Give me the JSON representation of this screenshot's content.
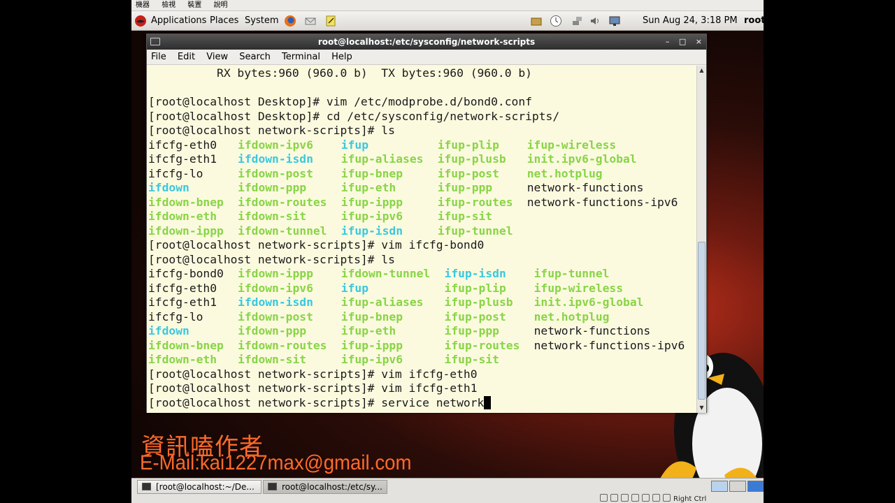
{
  "vm_menu": [
    "機器",
    "檢視",
    "裝置",
    "說明"
  ],
  "panel": {
    "menus": [
      "Applications",
      "Places",
      "System"
    ],
    "clock": "Sun Aug 24,  3:18 PM",
    "user": "root"
  },
  "window": {
    "title": "root@localhost:/etc/sysconfig/network-scripts",
    "menu": [
      "File",
      "Edit",
      "View",
      "Search",
      "Terminal",
      "Help"
    ],
    "controls": [
      "–",
      "□",
      "×"
    ]
  },
  "colors": {
    "text": "#1a1a1a",
    "exec": "#8ad448",
    "link": "#3bc8de",
    "terminal_bg": "#fbfadf",
    "watermark": "#ff6a2a"
  },
  "terminal": {
    "lines": [
      [
        {
          "t": "          RX bytes:960 (960.0 b)  TX bytes:960 (960.0 b)",
          "c": "text"
        }
      ],
      [],
      [
        {
          "t": "[root@localhost Desktop]# vim /etc/modprobe.d/bond0.conf",
          "c": "text"
        }
      ],
      [
        {
          "t": "[root@localhost Desktop]# cd /etc/sysconfig/network-scripts/",
          "c": "text"
        }
      ],
      [
        {
          "t": "[root@localhost network-scripts]# ls",
          "c": "text"
        }
      ],
      [
        {
          "t": "ifcfg-eth0",
          "c": "text",
          "col": 0
        },
        {
          "t": "ifdown-ipv6",
          "c": "exec",
          "col": 13
        },
        {
          "t": "ifup",
          "c": "link",
          "col": 28
        },
        {
          "t": "ifup-plip",
          "c": "exec",
          "col": 42
        },
        {
          "t": "ifup-wireless",
          "c": "exec",
          "col": 55
        }
      ],
      [
        {
          "t": "ifcfg-eth1",
          "c": "text",
          "col": 0
        },
        {
          "t": "ifdown-isdn",
          "c": "link",
          "col": 13
        },
        {
          "t": "ifup-aliases",
          "c": "exec",
          "col": 28
        },
        {
          "t": "ifup-plusb",
          "c": "exec",
          "col": 42
        },
        {
          "t": "init.ipv6-global",
          "c": "exec",
          "col": 55
        }
      ],
      [
        {
          "t": "ifcfg-lo",
          "c": "text",
          "col": 0
        },
        {
          "t": "ifdown-post",
          "c": "exec",
          "col": 13
        },
        {
          "t": "ifup-bnep",
          "c": "exec",
          "col": 28
        },
        {
          "t": "ifup-post",
          "c": "exec",
          "col": 42
        },
        {
          "t": "net.hotplug",
          "c": "exec",
          "col": 55
        }
      ],
      [
        {
          "t": "ifdown",
          "c": "link",
          "col": 0
        },
        {
          "t": "ifdown-ppp",
          "c": "exec",
          "col": 13
        },
        {
          "t": "ifup-eth",
          "c": "exec",
          "col": 28
        },
        {
          "t": "ifup-ppp",
          "c": "exec",
          "col": 42
        },
        {
          "t": "network-functions",
          "c": "text",
          "col": 55
        }
      ],
      [
        {
          "t": "ifdown-bnep",
          "c": "exec",
          "col": 0
        },
        {
          "t": "ifdown-routes",
          "c": "exec",
          "col": 13
        },
        {
          "t": "ifup-ippp",
          "c": "exec",
          "col": 28
        },
        {
          "t": "ifup-routes",
          "c": "exec",
          "col": 42
        },
        {
          "t": "network-functions-ipv6",
          "c": "text",
          "col": 55
        }
      ],
      [
        {
          "t": "ifdown-eth",
          "c": "exec",
          "col": 0
        },
        {
          "t": "ifdown-sit",
          "c": "exec",
          "col": 13
        },
        {
          "t": "ifup-ipv6",
          "c": "exec",
          "col": 28
        },
        {
          "t": "ifup-sit",
          "c": "exec",
          "col": 42
        }
      ],
      [
        {
          "t": "ifdown-ippp",
          "c": "exec",
          "col": 0
        },
        {
          "t": "ifdown-tunnel",
          "c": "exec",
          "col": 13
        },
        {
          "t": "ifup-isdn",
          "c": "link",
          "col": 28
        },
        {
          "t": "ifup-tunnel",
          "c": "exec",
          "col": 42
        }
      ],
      [
        {
          "t": "[root@localhost network-scripts]# vim ifcfg-bond0",
          "c": "text"
        }
      ],
      [
        {
          "t": "[root@localhost network-scripts]# ls",
          "c": "text"
        }
      ],
      [
        {
          "t": "ifcfg-bond0",
          "c": "text",
          "col": 0
        },
        {
          "t": "ifdown-ippp",
          "c": "exec",
          "col": 13
        },
        {
          "t": "ifdown-tunnel",
          "c": "exec",
          "col": 28
        },
        {
          "t": "ifup-isdn",
          "c": "link",
          "col": 43
        },
        {
          "t": "ifup-tunnel",
          "c": "exec",
          "col": 56
        }
      ],
      [
        {
          "t": "ifcfg-eth0",
          "c": "text",
          "col": 0
        },
        {
          "t": "ifdown-ipv6",
          "c": "exec",
          "col": 13
        },
        {
          "t": "ifup",
          "c": "link",
          "col": 28
        },
        {
          "t": "ifup-plip",
          "c": "exec",
          "col": 43
        },
        {
          "t": "ifup-wireless",
          "c": "exec",
          "col": 56
        }
      ],
      [
        {
          "t": "ifcfg-eth1",
          "c": "text",
          "col": 0
        },
        {
          "t": "ifdown-isdn",
          "c": "link",
          "col": 13
        },
        {
          "t": "ifup-aliases",
          "c": "exec",
          "col": 28
        },
        {
          "t": "ifup-plusb",
          "c": "exec",
          "col": 43
        },
        {
          "t": "init.ipv6-global",
          "c": "exec",
          "col": 56
        }
      ],
      [
        {
          "t": "ifcfg-lo",
          "c": "text",
          "col": 0
        },
        {
          "t": "ifdown-post",
          "c": "exec",
          "col": 13
        },
        {
          "t": "ifup-bnep",
          "c": "exec",
          "col": 28
        },
        {
          "t": "ifup-post",
          "c": "exec",
          "col": 43
        },
        {
          "t": "net.hotplug",
          "c": "exec",
          "col": 56
        }
      ],
      [
        {
          "t": "ifdown",
          "c": "link",
          "col": 0
        },
        {
          "t": "ifdown-ppp",
          "c": "exec",
          "col": 13
        },
        {
          "t": "ifup-eth",
          "c": "exec",
          "col": 28
        },
        {
          "t": "ifup-ppp",
          "c": "exec",
          "col": 43
        },
        {
          "t": "network-functions",
          "c": "text",
          "col": 56
        }
      ],
      [
        {
          "t": "ifdown-bnep",
          "c": "exec",
          "col": 0
        },
        {
          "t": "ifdown-routes",
          "c": "exec",
          "col": 13
        },
        {
          "t": "ifup-ippp",
          "c": "exec",
          "col": 28
        },
        {
          "t": "ifup-routes",
          "c": "exec",
          "col": 43
        },
        {
          "t": "network-functions-ipv6",
          "c": "text",
          "col": 56
        }
      ],
      [
        {
          "t": "ifdown-eth",
          "c": "exec",
          "col": 0
        },
        {
          "t": "ifdown-sit",
          "c": "exec",
          "col": 13
        },
        {
          "t": "ifup-ipv6",
          "c": "exec",
          "col": 28
        },
        {
          "t": "ifup-sit",
          "c": "exec",
          "col": 43
        }
      ],
      [
        {
          "t": "[root@localhost network-scripts]# vim ifcfg-eth0",
          "c": "text"
        }
      ],
      [
        {
          "t": "[root@localhost network-scripts]# vim ifcfg-eth1",
          "c": "text"
        }
      ],
      [
        {
          "t": "[root@localhost network-scripts]# service network",
          "c": "text",
          "cursor": true
        }
      ]
    ]
  },
  "watermark": {
    "author": "資訊嗑作者",
    "email": "E-Mail:kai1227max@gmail.com"
  },
  "taskbar": {
    "items": [
      {
        "label": "[root@localhost:~/De...",
        "active": false
      },
      {
        "label": "root@localhost:/etc/sy...",
        "active": true
      }
    ],
    "vm_status_text": "Right Ctrl"
  }
}
